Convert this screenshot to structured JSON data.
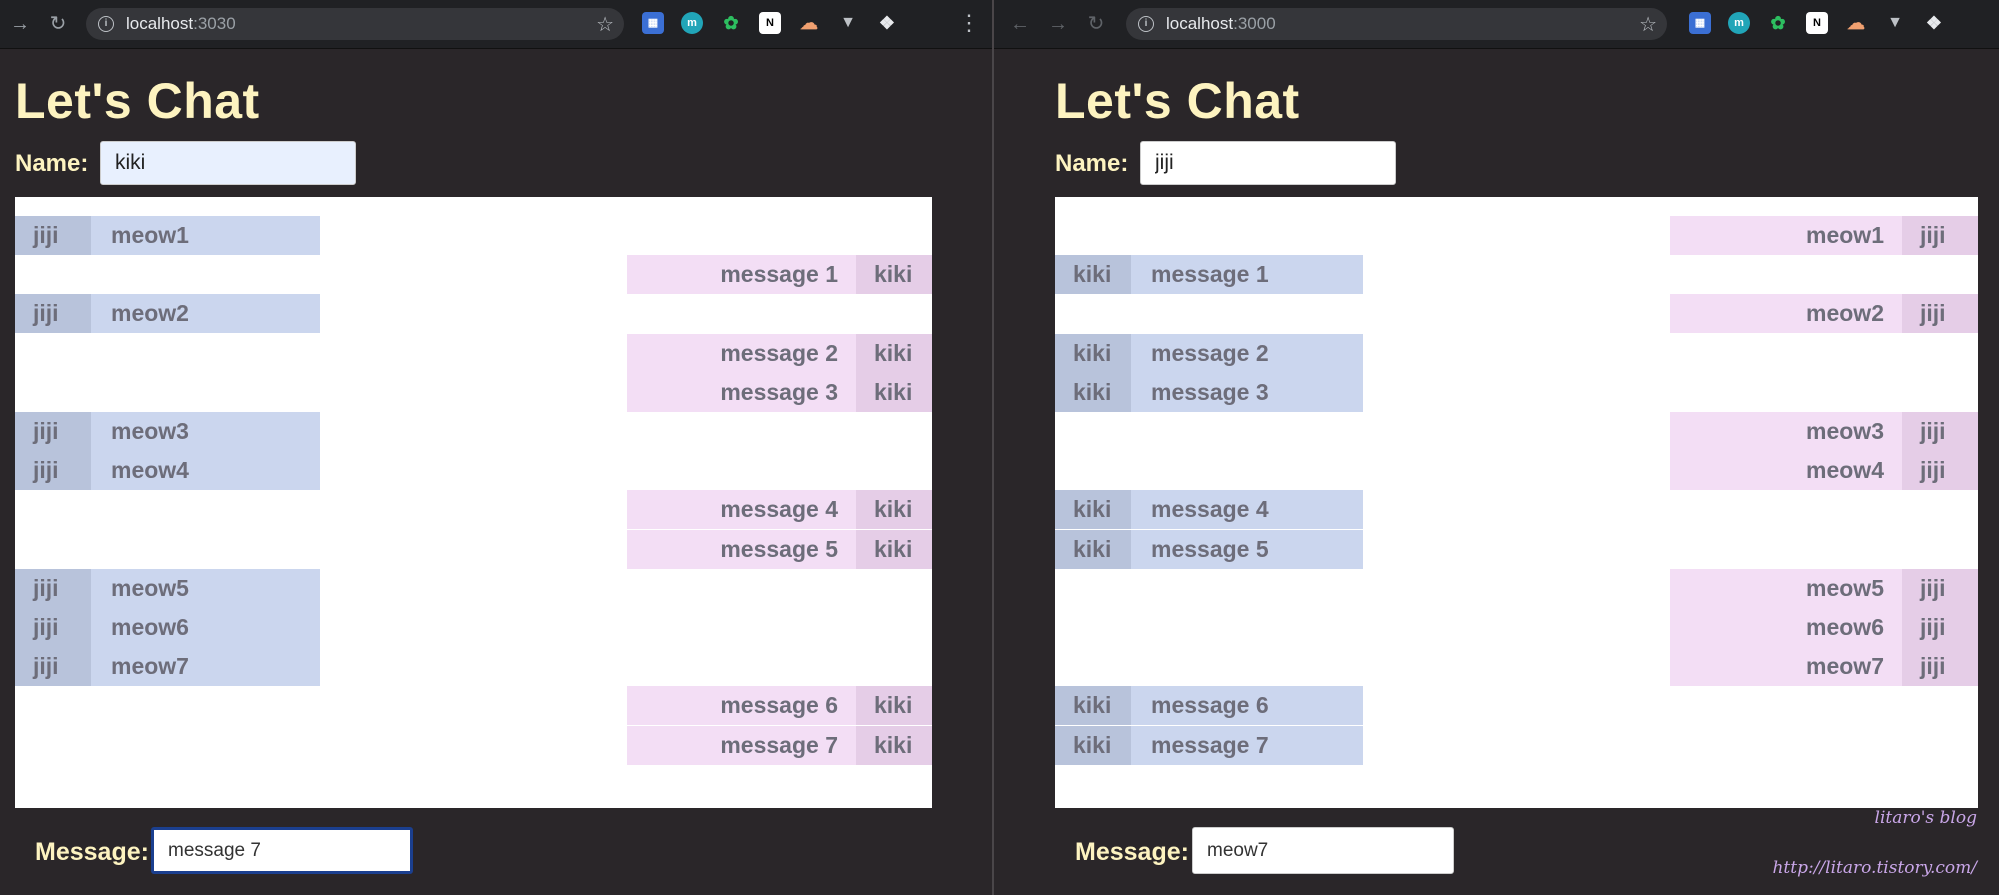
{
  "left": {
    "url_host": "localhost",
    "url_port": ":3030",
    "title": "Let's Chat",
    "name_label": "Name:",
    "name_value": "kiki",
    "message_label": "Message:",
    "message_value": "message 7"
  },
  "right": {
    "url_host": "localhost",
    "url_port": ":3000",
    "title": "Let's Chat",
    "name_label": "Name:",
    "name_value": "jiji",
    "message_label": "Message:",
    "message_value": "meow7"
  },
  "messages": [
    {
      "user": "jiji",
      "text": "meow1"
    },
    {
      "user": "kiki",
      "text": "message 1"
    },
    {
      "user": "jiji",
      "text": "meow2"
    },
    {
      "user": "kiki",
      "text": "message 2"
    },
    {
      "user": "kiki",
      "text": "message 3"
    },
    {
      "user": "jiji",
      "text": "meow3"
    },
    {
      "user": "jiji",
      "text": "meow4"
    },
    {
      "user": "kiki",
      "text": "message 4"
    },
    {
      "user": "kiki",
      "text": "message 5"
    },
    {
      "user": "jiji",
      "text": "meow5"
    },
    {
      "user": "jiji",
      "text": "meow6"
    },
    {
      "user": "jiji",
      "text": "meow7"
    },
    {
      "user": "kiki",
      "text": "message 6"
    },
    {
      "user": "kiki",
      "text": "message 7"
    }
  ],
  "colors": {
    "page_bg": "#2a2629",
    "title": "#fdf3c0",
    "self_bubble": "#f3def5",
    "other_bubble": "#cbd6ee"
  },
  "watermark": {
    "line1": "litaro's blog",
    "line2": "http://litaro.tistory.com/"
  }
}
